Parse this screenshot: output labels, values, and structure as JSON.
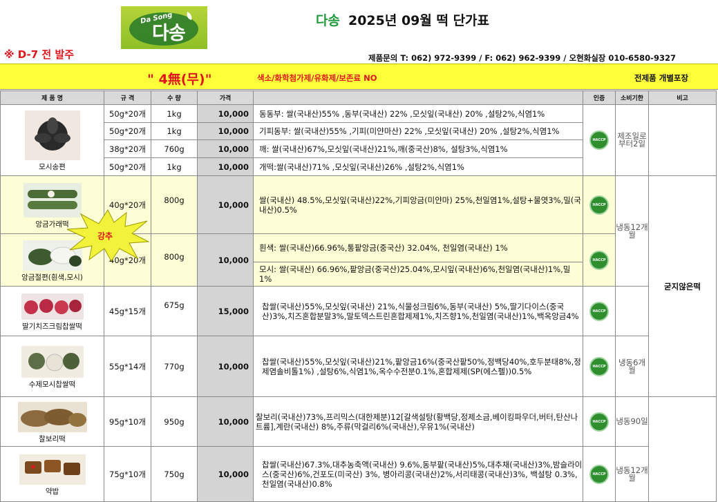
{
  "logo": {
    "sub": "Da Song",
    "main": "다송"
  },
  "header": {
    "brand": "다송",
    "title": "2025년 09월  떡 단가표",
    "order_note": "※ D-7 전 발주",
    "contact": "제품문의 T: 062) 972-9399  / F: 062) 962-9399 / 오현화실장 010-6580-9327"
  },
  "banner": {
    "free_label": "\" 4無(무)\"",
    "free_detail": "색소/화학첨가제/유화제/보존료 NO",
    "packaging": "전제품 개별포장"
  },
  "columns": {
    "name": "제 품 명",
    "spec": "규 격",
    "qty": "수 량",
    "price": "가격",
    "ingredients": "",
    "cert": "인증",
    "shelf": "소비기한",
    "remark": "비고"
  },
  "promo_badge": "강추",
  "products": [
    {
      "name": "모시송편",
      "variants": [
        {
          "spec": "50g*20개",
          "qty": "1kg",
          "price": "10,000",
          "ingredients": "동동부: 쌀(국내산)55% ,동부(국내산) 22% ,모싯잎(국내산) 20% ,설탕2%,식염1%"
        },
        {
          "spec": "50g*20개",
          "qty": "1kg",
          "price": "10,000",
          "ingredients": "기피동부: 쌀(국내산)55% ,기피(미얀마산) 22% ,모싯잎(국내산) 20% ,설탕2%,식염1%"
        },
        {
          "spec": "38g*20개",
          "qty": "760g",
          "price": "10,000",
          "ingredients": "깨: 쌀(국내산)67%,모싯잎(국내산)21%,깨(중국산)8%, 설탕3%,식염1%"
        },
        {
          "spec": "50g*20개",
          "qty": "1kg",
          "price": "10,000",
          "ingredients": "개떡:쌀(국내산)71% ,모싯잎(국내산)26% ,설탕2%,식염1%"
        }
      ],
      "cert": "HACCP",
      "shelf": "제조일로 부터2일"
    },
    {
      "name": "앙금가래떡",
      "spec": "40g*20개",
      "qty": "800g",
      "price": "10,000",
      "ingredients": "쌀(국내산) 48.5%,모싯잎(국내산)22%,기피앙금(미얀마) 25%,천일염1%,설탕+물엿3%,밀(국내산)0.5%",
      "cert": "HACCP"
    },
    {
      "name": "앙금절편(흰색,모시)",
      "spec": "40g*20개",
      "qty": "800g",
      "price": "10,000",
      "ingredients_white": "흰색:   쌀(국내산)66.96%,통팥앙금(중국산) 32.04%,  천일염(국내산)  1%",
      "ingredients_mosi": "모시: 쌀(국내산) 66.96%,팥앙금(중국산)25.04%,모시잎(국내산)6%,천일염(국내산)1%,밀1%",
      "cert": "HACCP"
    },
    {
      "name": "딸기치즈크림찹쌀떡",
      "spec": "45g*15개",
      "qty": "675g",
      "price": "15,000",
      "ingredients": "찹쌀(국내산)55%,모싯잎(국내산) 21%,식물성크림6%,동부(국내산) 5%,딸기다이스(중국산)3%,치즈혼합분말3%,말토덱스트린혼합제제1%,치즈향1%,천일염(국내산)1%,백옥앙금4%",
      "cert": "HACCP"
    },
    {
      "name": "수제모시찹쌀떡",
      "spec": "55g*14개",
      "qty": "770g",
      "price": "10,000",
      "ingredients": "찹쌀(국내산)55%,모싯잎(국내산)21%,팥앙금16%(중국산팥50%,정백당40%,호두분태8%,정제염솔비톨1%) ,설탕6%,식염1%,옥수수전분0.1%,혼합제제(SP(에스펠))0.5%",
      "cert": "HACCP",
      "shelf": "냉동6개월"
    },
    {
      "name": "찰보리떡",
      "spec": "95g*10개",
      "qty": "950g",
      "price": "10,000",
      "ingredients": "찰보리(국내산)73%,프리믹스(대한제분)12[갈색설탕(황백당,정제소금,베이킹파우더,버터,탄산나트륨],계란(국내산) 8%,주류(막걸리6%(국내산),우유1%(국내산)",
      "cert": "HACCP",
      "shelf": "냉동90일"
    },
    {
      "name": "약밥",
      "spec": "75g*10개",
      "qty": "750g",
      "price": "10,000",
      "ingredients": "찹쌀(국내산)67.3%,대추농축액(국내산) 9.6%,동부팥(국내산)5%,대추채(국내산)3%,밤슬라이스(중국산)6%,건포도(미국산) 3%, 병아리콩(국내산)2%,서리태콩(국내산)3%, 백설탕 0.3%,천일염(국내산)0.8%",
      "cert": "HACCP",
      "shelf": "냉동12개월"
    }
  ],
  "group_shelf_frozen12": "냉동12개월",
  "group_remark": "굳지않은떡"
}
